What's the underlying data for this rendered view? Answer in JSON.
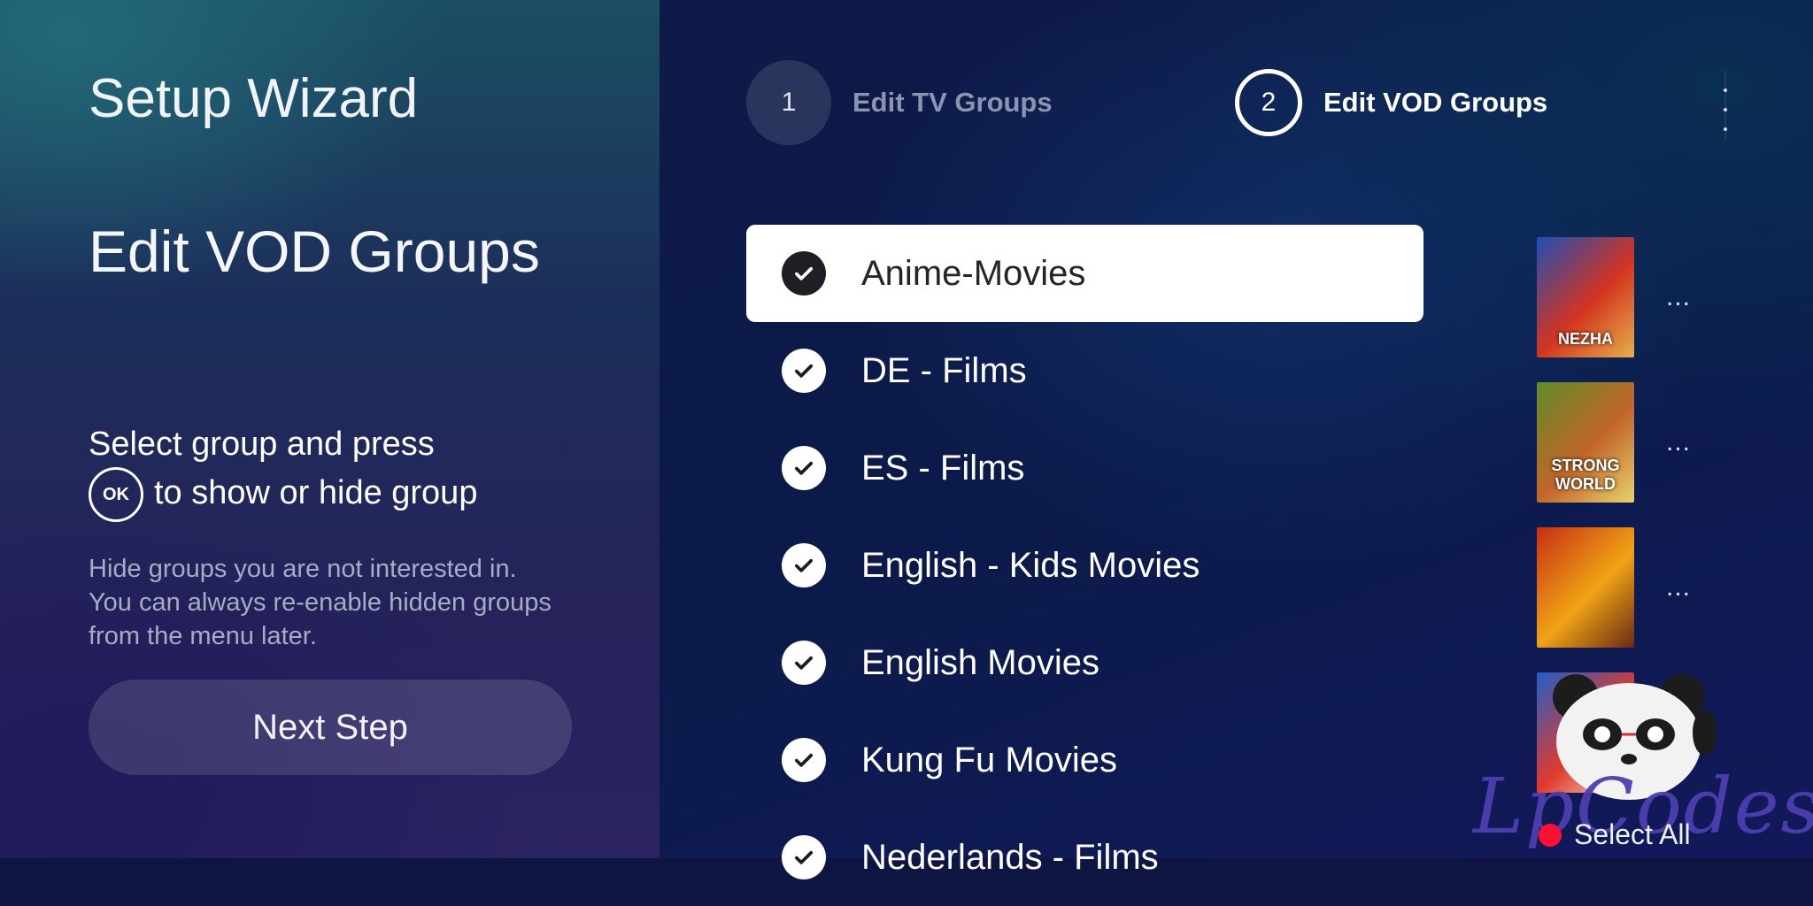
{
  "wizard": {
    "title": "Setup Wizard",
    "section_title": "Edit VOD Groups",
    "instruction_before": "Select group and press",
    "ok_label": "OK",
    "instruction_after": "to show or hide group",
    "hint": "Hide groups you are not interested in. You can always re-enable hidden groups from the menu later.",
    "next_button": "Next Step"
  },
  "steps": [
    {
      "number": "1",
      "label": "Edit TV Groups",
      "active": false
    },
    {
      "number": "2",
      "label": "Edit VOD Groups",
      "active": true
    }
  ],
  "groups": [
    {
      "label": "Anime-Movies",
      "checked": true,
      "selected": true
    },
    {
      "label": "DE - Films",
      "checked": true,
      "selected": false
    },
    {
      "label": "ES - Films",
      "checked": true,
      "selected": false
    },
    {
      "label": "English - Kids Movies",
      "checked": true,
      "selected": false
    },
    {
      "label": "English Movies",
      "checked": true,
      "selected": false
    },
    {
      "label": "Kung Fu Movies",
      "checked": true,
      "selected": false
    },
    {
      "label": "Nederlands - Films",
      "checked": true,
      "selected": false
    }
  ],
  "posters": [
    {
      "title": "NEZHA",
      "colors": [
        "#1d4fb4",
        "#d3351f",
        "#e6b04a"
      ]
    },
    {
      "title": "STRONG WORLD",
      "colors": [
        "#5f8b27",
        "#c3662a",
        "#e8d36e"
      ]
    },
    {
      "title": "",
      "colors": [
        "#c72f14",
        "#f0a316",
        "#6b2a13"
      ]
    },
    {
      "title": "",
      "colors": [
        "#1f5fc9",
        "#e13a2a",
        "#f0e6d8"
      ]
    }
  ],
  "more_label": "...",
  "select_all_label": "Select All",
  "watermark": "LpCodes"
}
